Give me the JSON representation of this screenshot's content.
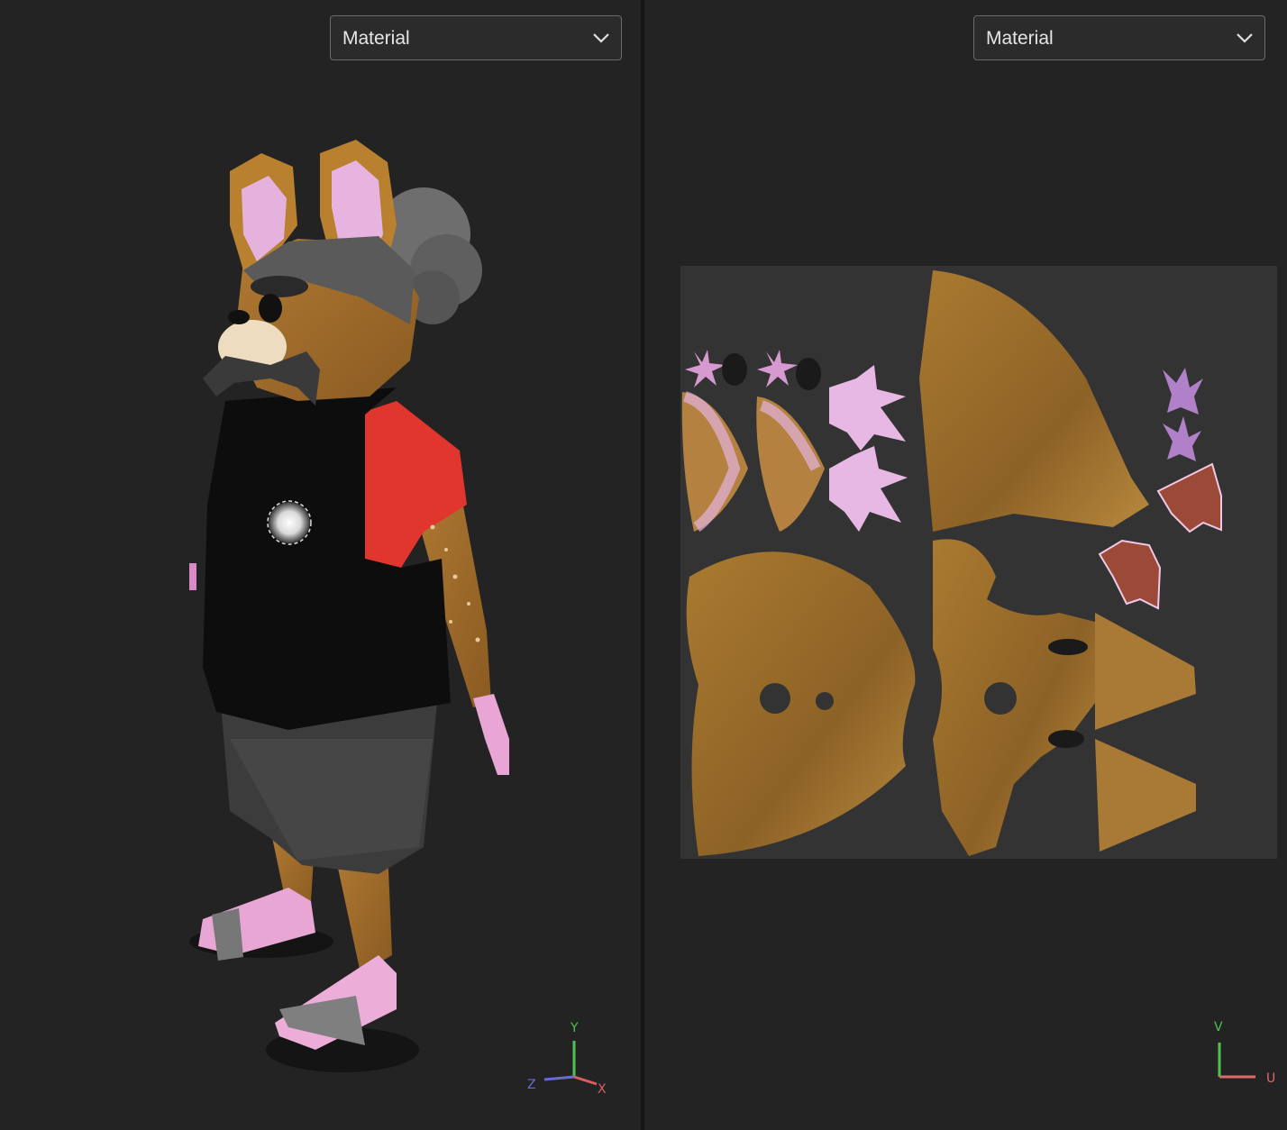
{
  "left_viewport": {
    "mode_dropdown": {
      "selected": "Material"
    },
    "axis_gizmo": {
      "labels": [
        "Y",
        "Z",
        "X"
      ]
    },
    "colors": {
      "y_axis": "#4cc34c",
      "z_axis": "#6b6bd6",
      "x_axis": "#d66060"
    }
  },
  "right_viewport": {
    "mode_dropdown": {
      "selected": "Material"
    },
    "axis_gizmo": {
      "labels": [
        "V",
        "U"
      ]
    },
    "colors": {
      "v_axis": "#4cc34c",
      "u_axis": "#e06a6a",
      "uv_background": "#333333"
    }
  },
  "icons": {
    "dropdown": "chevron-down-icon",
    "light": "point-light-gizmo-icon"
  }
}
